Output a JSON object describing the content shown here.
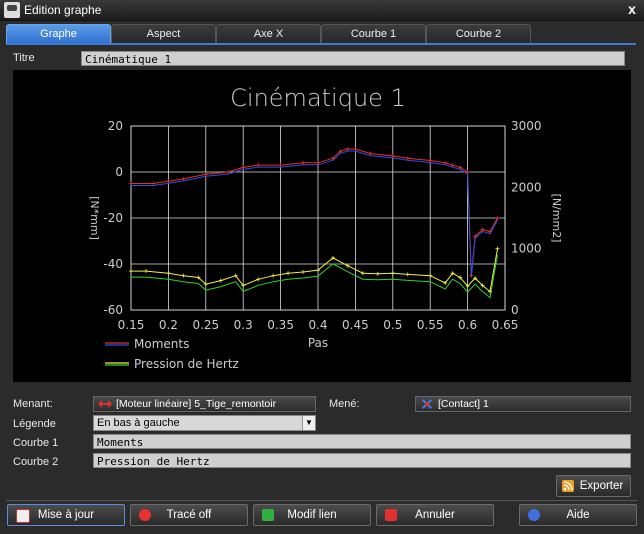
{
  "window": {
    "title": "Edition graphe",
    "close_label": "x"
  },
  "tabs": [
    {
      "label": "Graphe",
      "active": true
    },
    {
      "label": "Aspect"
    },
    {
      "label": "Axe X"
    },
    {
      "label": "Courbe 1"
    },
    {
      "label": "Courbe 2"
    }
  ],
  "titre": {
    "label": "Titre",
    "value": "Cinématique 1"
  },
  "chart_data": {
    "type": "line",
    "title": "Cinématique 1",
    "xlabel": "Pas",
    "ylabel": "[N*mm]",
    "y2label": "[N/mm2]",
    "xlim": [
      0.15,
      0.65
    ],
    "ylim": [
      -60,
      20
    ],
    "y2lim": [
      0,
      3000
    ],
    "x_ticks": [
      "0.15",
      "0.2",
      "0.25",
      "0.3",
      "0.35",
      "0.4",
      "0.45",
      "0.5",
      "0.55",
      "0.6",
      "0.65"
    ],
    "y_ticks": [
      "20",
      "0",
      "-20",
      "-40",
      "-60"
    ],
    "y2_ticks": [
      "3000",
      "2000",
      "1000",
      "0"
    ],
    "grid": true,
    "legend_position": "bottom-left",
    "series": [
      {
        "name": "Moments",
        "axis": "left",
        "color": "#e03030",
        "color2": "#3050e0",
        "x": [
          0.15,
          0.18,
          0.2,
          0.22,
          0.25,
          0.28,
          0.3,
          0.32,
          0.35,
          0.38,
          0.4,
          0.42,
          0.43,
          0.44,
          0.45,
          0.47,
          0.5,
          0.52,
          0.55,
          0.57,
          0.58,
          0.59,
          0.6,
          0.605,
          0.61,
          0.62,
          0.63,
          0.64
        ],
        "values": [
          -5,
          -5,
          -4,
          -3,
          -1,
          0,
          2,
          3,
          3,
          4,
          4,
          6,
          9,
          10,
          10,
          8,
          7,
          6,
          5,
          4,
          3,
          2,
          0,
          -45,
          -28,
          -25,
          -26,
          -20
        ]
      },
      {
        "name": "Pression de Hertz",
        "axis": "right",
        "color": "#f0f040",
        "color2": "#30d030",
        "x": [
          0.15,
          0.17,
          0.2,
          0.22,
          0.24,
          0.25,
          0.27,
          0.29,
          0.3,
          0.32,
          0.34,
          0.36,
          0.38,
          0.4,
          0.42,
          0.44,
          0.46,
          0.48,
          0.5,
          0.52,
          0.55,
          0.57,
          0.58,
          0.59,
          0.6,
          0.61,
          0.62,
          0.63,
          0.64
        ],
        "values": [
          635,
          635,
          600,
          560,
          530,
          420,
          480,
          560,
          400,
          500,
          560,
          600,
          620,
          650,
          850,
          720,
          600,
          590,
          600,
          580,
          560,
          440,
          600,
          530,
          390,
          520,
          400,
          300,
          1000
        ]
      }
    ]
  },
  "menant": {
    "label": "Menant:",
    "value": "[Moteur linéaire] 5_Tige_remontoir"
  },
  "mene": {
    "label": "Mené:",
    "value": "[Contact] 1"
  },
  "legende": {
    "label": "Légende",
    "value": "En bas à gauche"
  },
  "courbe1": {
    "label": "Courbe 1",
    "value": "Moments"
  },
  "courbe2": {
    "label": "Courbe 2",
    "value": "Pression de Hertz"
  },
  "exporter": {
    "label": "Exporter"
  },
  "buttons": {
    "mise_a_jour": "Mise à jour",
    "trace_off": "Tracé off",
    "modif_lien": "Modif lien",
    "annuler": "Annuler",
    "aide": "Aide"
  }
}
